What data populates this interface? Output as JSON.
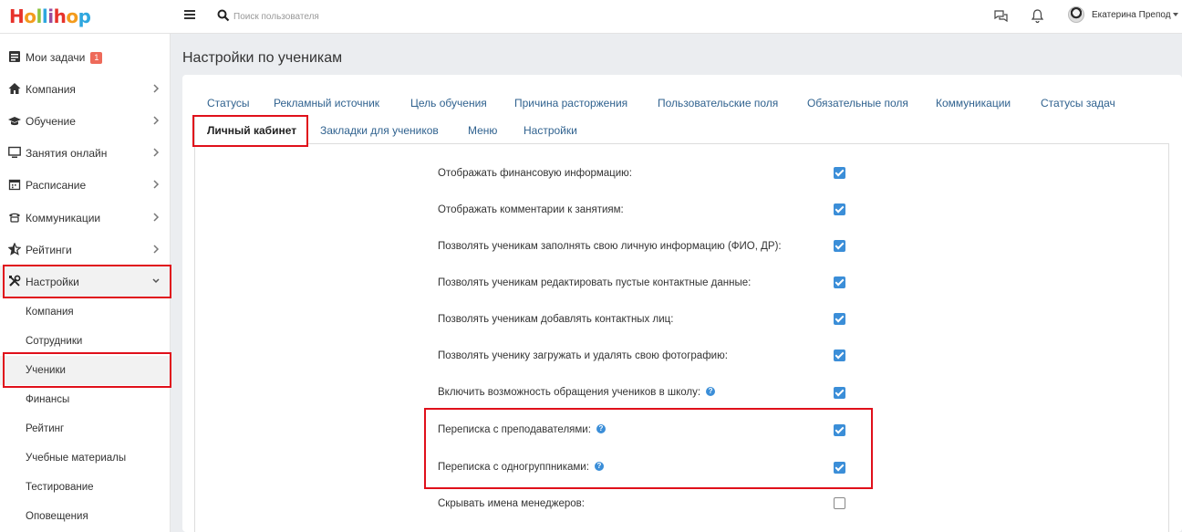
{
  "app": {
    "logo_letters": [
      "H",
      "o",
      "l",
      "l",
      "i",
      "h",
      "o",
      "p"
    ],
    "logo_colors": [
      "#e7322b",
      "#f39b1d",
      "#8dc43e",
      "#2fa7df",
      "#9b4d9e",
      "#e7322b",
      "#f39b1d",
      "#2fa7df"
    ]
  },
  "header": {
    "search_placeholder": "Поиск пользователя",
    "user_name": "Екатерина Препод"
  },
  "sidebar": {
    "items": [
      {
        "label": "Мои задачи",
        "badge": "1",
        "icon": "tasks-icon"
      },
      {
        "label": "Компания",
        "icon": "home-icon"
      },
      {
        "label": "Обучение",
        "icon": "graduation-cap-icon"
      },
      {
        "label": "Занятия онлайн",
        "icon": "monitor-icon"
      },
      {
        "label": "Расписание",
        "icon": "calendar-icon"
      },
      {
        "label": "Коммуникации",
        "icon": "phone-icon"
      },
      {
        "label": "Рейтинги",
        "icon": "star-icon"
      },
      {
        "label": "Настройки",
        "icon": "tools-icon"
      }
    ],
    "subitems": [
      "Компания",
      "Сотрудники",
      "Ученики",
      "Финансы",
      "Рейтинг",
      "Учебные материалы",
      "Тестирование",
      "Оповещения"
    ]
  },
  "main": {
    "title": "Настройки по ученикам",
    "tabs_row1": [
      "Статусы",
      "Рекламный источник",
      "Цель обучения",
      "Причина расторжения",
      "Пользовательские поля",
      "Обязательные поля",
      "Коммуникации",
      "Статусы задач"
    ],
    "tabs_row2": [
      "Личный кабинет",
      "Закладки для учеников",
      "Меню",
      "Настройки"
    ],
    "settings": [
      {
        "label": "Отображать финансовую информацию:",
        "checked": true,
        "help": false
      },
      {
        "label": "Отображать комментарии к занятиям:",
        "checked": true,
        "help": false
      },
      {
        "label": "Позволять ученикам заполнять свою личную информацию (ФИО, ДР):",
        "checked": true,
        "help": false
      },
      {
        "label": "Позволять ученикам редактировать пустые контактные данные:",
        "checked": true,
        "help": false
      },
      {
        "label": "Позволять ученикам добавлять контактных лиц:",
        "checked": true,
        "help": false
      },
      {
        "label": "Позволять ученику загружать и удалять свою фотографию:",
        "checked": true,
        "help": false
      },
      {
        "label": "Включить возможность обращения учеников в школу:",
        "checked": true,
        "help": true
      },
      {
        "label": "Переписка с преподавателями:",
        "checked": true,
        "help": true
      },
      {
        "label": "Переписка с одногруппниками:",
        "checked": true,
        "help": true
      },
      {
        "label": "Скрывать имена менеджеров:",
        "checked": false,
        "help": false
      }
    ]
  },
  "colors": {
    "accent": "#3b8ed8",
    "highlight": "#e0101b",
    "tab_link": "#30628f"
  }
}
